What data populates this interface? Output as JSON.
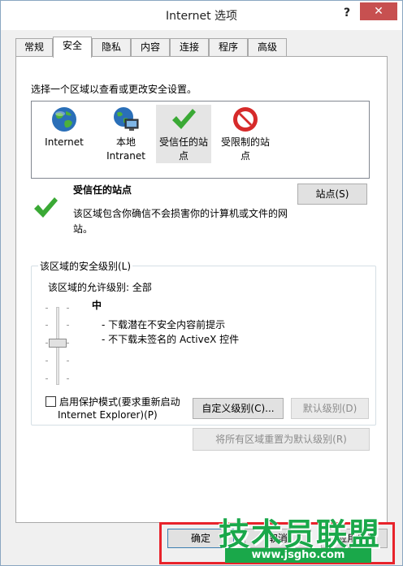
{
  "window": {
    "title": "Internet 选项",
    "help_label": "?",
    "close_label": "✕"
  },
  "tabs": [
    {
      "label": "常规",
      "active": false
    },
    {
      "label": "安全",
      "active": true
    },
    {
      "label": "隐私",
      "active": false
    },
    {
      "label": "内容",
      "active": false
    },
    {
      "label": "连接",
      "active": false
    },
    {
      "label": "程序",
      "active": false
    },
    {
      "label": "高级",
      "active": false
    }
  ],
  "security": {
    "prompt": "选择一个区域以查看或更改安全设置。",
    "zones": [
      {
        "label_line1": "Internet",
        "label_line2": "",
        "icon": "globe-icon"
      },
      {
        "label_line1": "本地",
        "label_line2": "Intranet",
        "icon": "intranet-icon"
      },
      {
        "label_line1": "受信任的站",
        "label_line2": "点",
        "icon": "checkmark-icon",
        "selected": true
      },
      {
        "label_line1": "受限制的站",
        "label_line2": "点",
        "icon": "no-entry-icon"
      }
    ],
    "zone_title": "受信任的站点",
    "zone_desc_line1": "该区域包含你确信不会损害你的计算机或文件的网",
    "zone_desc_line2": "站。",
    "sites_button": "站点(S)"
  },
  "level_group": {
    "label": "该区域的安全级别(L)",
    "allowed": "该区域的允许级别: 全部",
    "level_name": "中",
    "bullets": [
      "- 下载潜在不安全内容前提示",
      "- 不下载未签名的 ActiveX 控件"
    ],
    "protected_mode_line1": "启用保护模式(要求重新启动",
    "protected_mode_line2": "Internet Explorer)(P)",
    "custom_level_button": "自定义级别(C)...",
    "default_level_button": "默认级别(D)",
    "reset_all_button": "将所有区域重置为默认级别(R)"
  },
  "footer": {
    "ok_button": "确定",
    "cancel_button": "取消",
    "apply_button": "应用(A)"
  },
  "watermark": {
    "big": "技术员联盟",
    "small": "www.jsgho.com"
  },
  "colors": {
    "accent_green": "#3aa935",
    "close_red": "#c75050",
    "frame_red": "#e8232b"
  }
}
